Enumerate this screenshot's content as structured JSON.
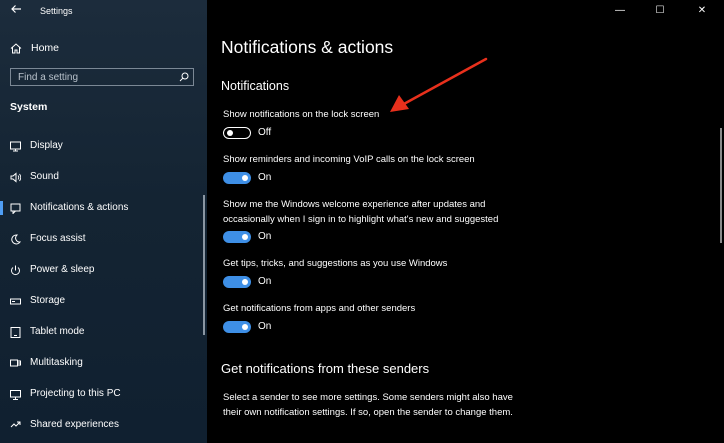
{
  "window": {
    "title": "Settings",
    "controls": {
      "minimize": "—",
      "maximize": "☐",
      "close": "✕"
    }
  },
  "sidebar": {
    "home_label": "Home",
    "search_placeholder": "Find a setting",
    "section": "System",
    "items": [
      {
        "label": "Display",
        "icon": "display-icon"
      },
      {
        "label": "Sound",
        "icon": "speaker-icon"
      },
      {
        "label": "Notifications & actions",
        "icon": "notification-icon",
        "active": true
      },
      {
        "label": "Focus assist",
        "icon": "moon-icon"
      },
      {
        "label": "Power & sleep",
        "icon": "power-icon"
      },
      {
        "label": "Storage",
        "icon": "storage-icon"
      },
      {
        "label": "Tablet mode",
        "icon": "tablet-icon"
      },
      {
        "label": "Multitasking",
        "icon": "multitasking-icon"
      },
      {
        "label": "Projecting to this PC",
        "icon": "projector-icon"
      },
      {
        "label": "Shared experiences",
        "icon": "shared-icon"
      }
    ]
  },
  "main": {
    "title": "Notifications & actions",
    "section_title": "Notifications",
    "settings": [
      {
        "label": "Show notifications on the lock screen",
        "state": "Off",
        "on": false
      },
      {
        "label": "Show reminders and incoming VoIP calls on the lock screen",
        "state": "On",
        "on": true
      },
      {
        "label": "Show me the Windows welcome experience after updates and occasionally when I sign in to highlight what's new and suggested",
        "state": "On",
        "on": true
      },
      {
        "label": "Get tips, tricks, and suggestions as you use Windows",
        "state": "On",
        "on": true
      },
      {
        "label": "Get notifications from apps and other senders",
        "state": "On",
        "on": true
      }
    ],
    "senders_title": "Get notifications from these senders",
    "senders_desc": "Select a sender to see more settings. Some senders might also have their own notification settings. If so, open the sender to change them."
  },
  "colors": {
    "accent": "#3e8fe6",
    "annotation_arrow": "#e8301c",
    "sidebar_bg": "#142433"
  }
}
